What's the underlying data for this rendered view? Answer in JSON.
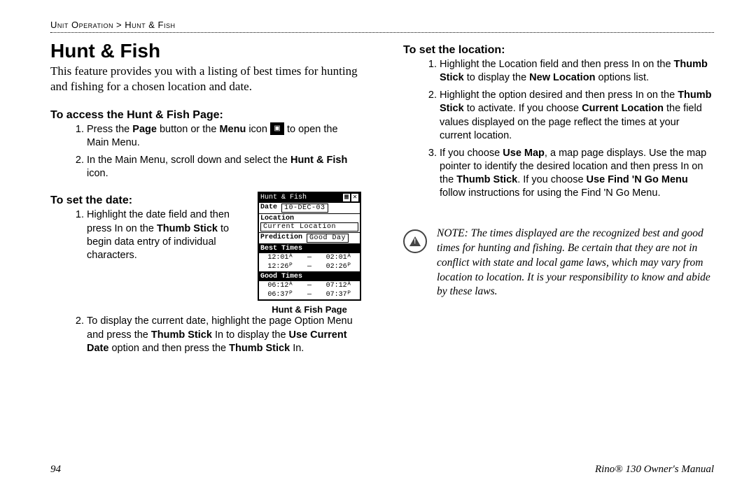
{
  "breadcrumb": "Unit Operation > Hunt & Fish",
  "title": "Hunt & Fish",
  "intro": "This feature provides you with a listing of best times for hunting and fishing for a chosen location and date.",
  "access": {
    "heading": "To access the Hunt & Fish Page:",
    "items": [
      {
        "pre": "Press the ",
        "b1": "Page",
        "mid": " button or the ",
        "b2": "Menu",
        "post_icon": " icon ",
        "post": " to open the Main Menu."
      },
      {
        "text": "In the Main Menu, scroll down and select the ",
        "b": "Hunt & Fish",
        "post": " icon."
      }
    ]
  },
  "date": {
    "heading": "To set the date:",
    "items": [
      "Highlight the date field and then press In on the Thumb Stick to begin data entry of individual characters.",
      "To display the current date, highlight the page Option Menu and press the Thumb Stick In to display the Use Current Date option and then press the Thumb Stick In."
    ]
  },
  "figure": {
    "title": "Hunt & Fish",
    "date_label": "Date",
    "date_value": "10-DEC-03",
    "location_label": "Location",
    "location_value": "Current Location",
    "prediction_label": "Prediction",
    "prediction_value": "Good Day",
    "best_label": "Best Times",
    "best_rows": [
      [
        "12:01ᴬ",
        "—",
        "02:01ᴬ"
      ],
      [
        "12:26ᴾ",
        "—",
        "02:26ᴾ"
      ]
    ],
    "good_label": "Good Times",
    "good_rows": [
      [
        "06:12ᴬ",
        "—",
        "07:12ᴬ"
      ],
      [
        "06:37ᴾ",
        "—",
        "07:37ᴾ"
      ]
    ],
    "caption": "Hunt & Fish Page"
  },
  "location": {
    "heading": "To set the location:",
    "items_html": [
      "Highlight the Location field and then press In on the <b>Thumb Stick</b> to display the <b>New Location</b> options list.",
      "Highlight the option desired and then press In on the <b>Thumb Stick</b> to activate. If you choose <b>Current Location</b> the field values displayed on the page reflect the times at your current location.",
      "If you choose <b>Use Map</b>, a map page displays. Use the map pointer to identify the desired location and then press In on the <b>Thumb Stick</b>. If you choose <b>Use Find 'N Go Menu</b> follow instructions for using the Find 'N Go Menu."
    ]
  },
  "note": "NOTE: The times displayed are the recognized best and good times for hunting and fishing. Be certain that they are not in conflict with state and local game laws, which may vary from location to location. It is your responsibility to know and abide by these laws.",
  "footer": {
    "page_num": "94",
    "manual": "Rino® 130 Owner's Manual"
  }
}
